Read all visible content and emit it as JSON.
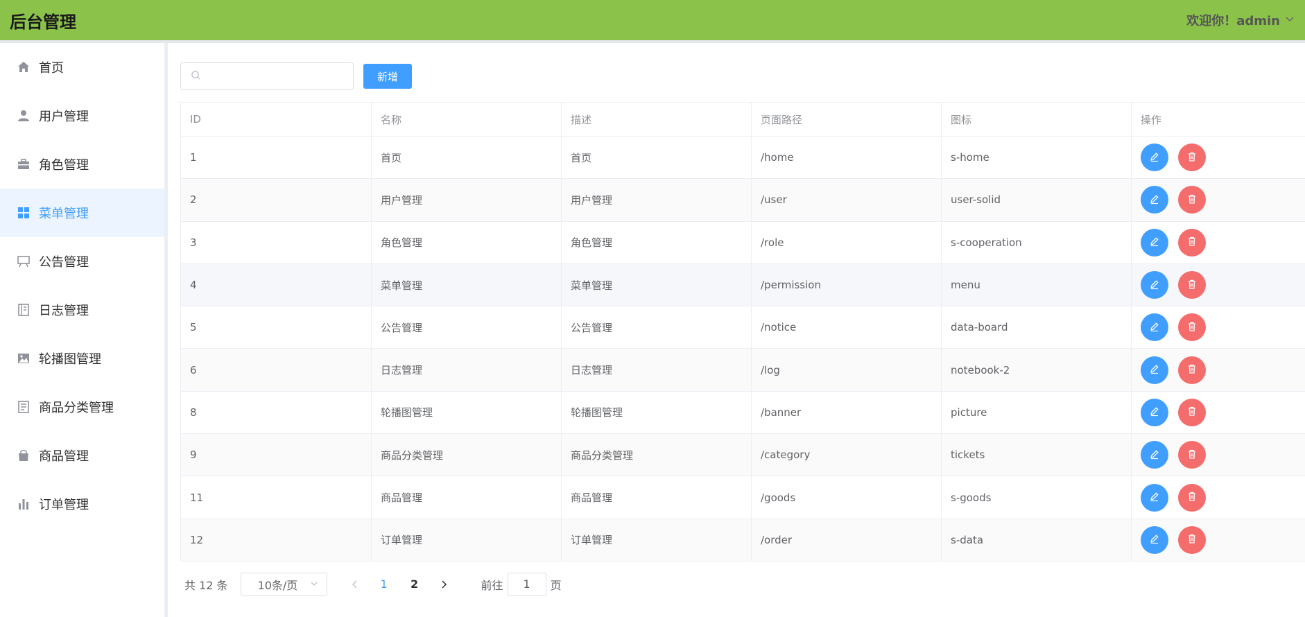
{
  "header": {
    "title": "后台管理",
    "welcome": "欢迎你！admin"
  },
  "sidebar": {
    "items": [
      {
        "label": "首页",
        "icon": "home-icon"
      },
      {
        "label": "用户管理",
        "icon": "user-icon"
      },
      {
        "label": "角色管理",
        "icon": "briefcase-icon"
      },
      {
        "label": "菜单管理",
        "icon": "grid-icon",
        "active": true
      },
      {
        "label": "公告管理",
        "icon": "board-icon"
      },
      {
        "label": "日志管理",
        "icon": "notebook-icon"
      },
      {
        "label": "轮播图管理",
        "icon": "picture-icon"
      },
      {
        "label": "商品分类管理",
        "icon": "tickets-icon"
      },
      {
        "label": "商品管理",
        "icon": "bag-icon"
      },
      {
        "label": "订单管理",
        "icon": "bar-chart-icon"
      }
    ]
  },
  "toolbar": {
    "search_value": "",
    "add_label": "新增"
  },
  "table": {
    "headers": [
      "ID",
      "名称",
      "描述",
      "页面路径",
      "图标",
      "操作"
    ],
    "rows": [
      {
        "id": "1",
        "name": "首页",
        "desc": "首页",
        "path": "/home",
        "icon": "s-home"
      },
      {
        "id": "2",
        "name": "用户管理",
        "desc": "用户管理",
        "path": "/user",
        "icon": "user-solid"
      },
      {
        "id": "3",
        "name": "角色管理",
        "desc": "角色管理",
        "path": "/role",
        "icon": "s-cooperation"
      },
      {
        "id": "4",
        "name": "菜单管理",
        "desc": "菜单管理",
        "path": "/permission",
        "icon": "menu"
      },
      {
        "id": "5",
        "name": "公告管理",
        "desc": "公告管理",
        "path": "/notice",
        "icon": "data-board"
      },
      {
        "id": "6",
        "name": "日志管理",
        "desc": "日志管理",
        "path": "/log",
        "icon": "notebook-2"
      },
      {
        "id": "8",
        "name": "轮播图管理",
        "desc": "轮播图管理",
        "path": "/banner",
        "icon": "picture"
      },
      {
        "id": "9",
        "name": "商品分类管理",
        "desc": "商品分类管理",
        "path": "/category",
        "icon": "tickets"
      },
      {
        "id": "11",
        "name": "商品管理",
        "desc": "商品管理",
        "path": "/goods",
        "icon": "s-goods"
      },
      {
        "id": "12",
        "name": "订单管理",
        "desc": "订单管理",
        "path": "/order",
        "icon": "s-data"
      }
    ]
  },
  "pagination": {
    "total": "共 12 条",
    "page_size": "10条/页",
    "pages": [
      "1",
      "2"
    ],
    "current_page": "1",
    "goto_prefix": "前往",
    "goto_value": "1",
    "goto_suffix": "页"
  },
  "colors": {
    "header_bg": "#8bc34a",
    "primary": "#409eff",
    "danger": "#f56c6c",
    "active_menu_bg": "#ecf5ff"
  }
}
